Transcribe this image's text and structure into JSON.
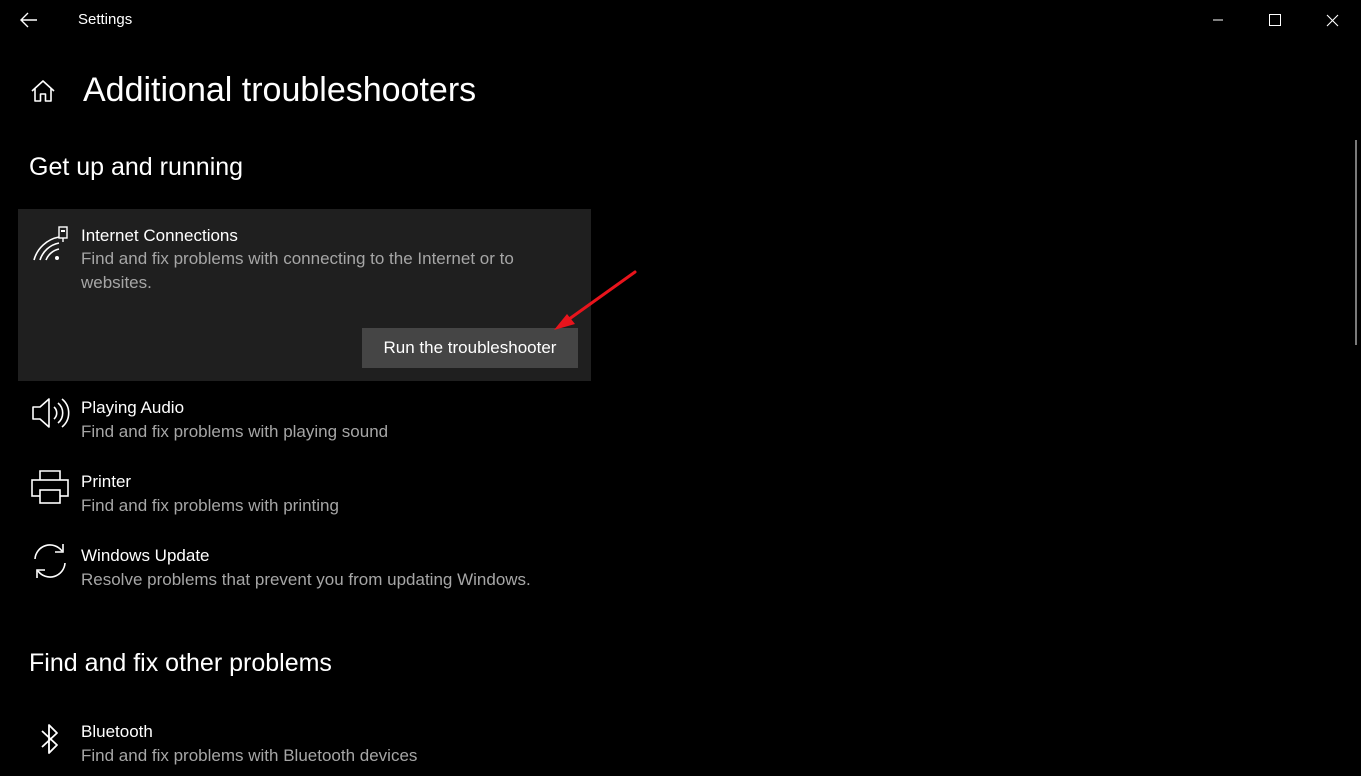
{
  "window": {
    "app_title": "Settings"
  },
  "page": {
    "title": "Additional troubleshooters"
  },
  "sections": {
    "get_up_and_running": {
      "title": "Get up and running",
      "items": [
        {
          "icon": "wifi-network-icon",
          "title": "Internet Connections",
          "description": "Find and fix problems with connecting to the Internet or to websites.",
          "button_label": "Run the troubleshooter"
        },
        {
          "icon": "speaker-icon",
          "title": "Playing Audio",
          "description": "Find and fix problems with playing sound"
        },
        {
          "icon": "printer-icon",
          "title": "Printer",
          "description": "Find and fix problems with printing"
        },
        {
          "icon": "sync-icon",
          "title": "Windows Update",
          "description": "Resolve problems that prevent you from updating Windows."
        }
      ]
    },
    "find_and_fix_other": {
      "title": "Find and fix other problems",
      "items": [
        {
          "icon": "bluetooth-icon",
          "title": "Bluetooth",
          "description": "Find and fix problems with Bluetooth devices"
        }
      ]
    }
  },
  "colors": {
    "background": "#000000",
    "card_background": "#1f1f1f",
    "button_background": "#454545",
    "secondary_text": "#a6a6a6",
    "annotation_arrow": "#e8141c"
  }
}
